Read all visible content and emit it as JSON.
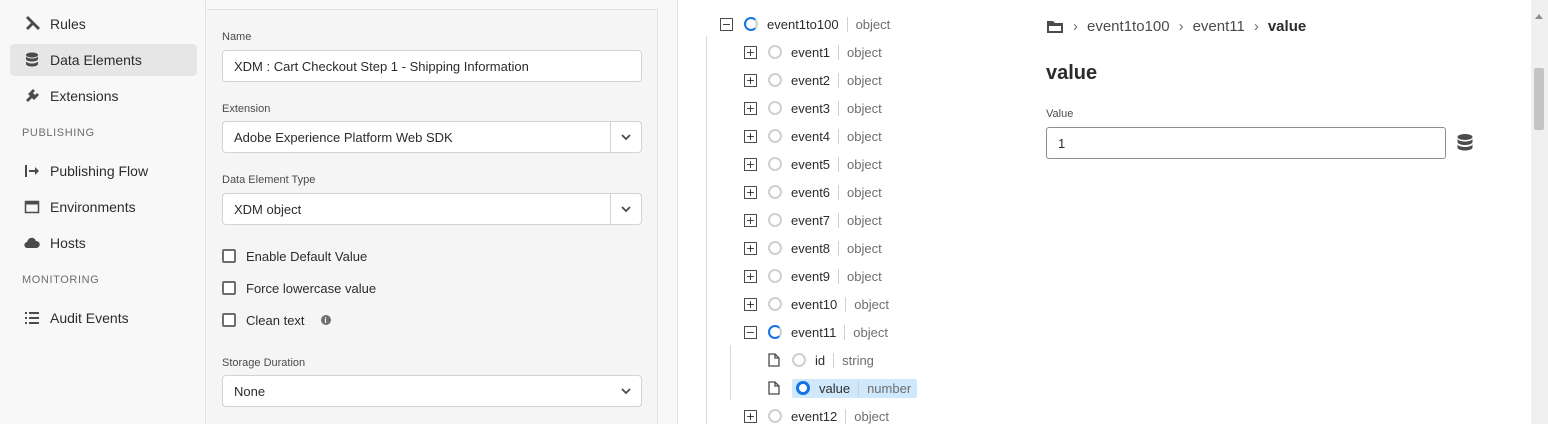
{
  "sidebar": {
    "items": [
      {
        "label": "Rules",
        "icon": "hammer-icon"
      },
      {
        "label": "Data Elements",
        "icon": "database-icon"
      },
      {
        "label": "Extensions",
        "icon": "plug-icon"
      },
      {
        "label": "Publishing Flow",
        "icon": "publish-flow-icon"
      },
      {
        "label": "Environments",
        "icon": "window-icon"
      },
      {
        "label": "Hosts",
        "icon": "cloud-icon"
      },
      {
        "label": "Audit Events",
        "icon": "list-icon"
      }
    ],
    "sections": {
      "publishing": "PUBLISHING",
      "monitoring": "MONITORING"
    }
  },
  "form": {
    "name_label": "Name",
    "name_value": "XDM : Cart Checkout Step 1 - Shipping Information",
    "extension_label": "Extension",
    "extension_value": "Adobe Experience Platform Web SDK",
    "type_label": "Data Element Type",
    "type_value": "XDM object",
    "checkboxes": [
      {
        "label": "Enable Default Value"
      },
      {
        "label": "Force lowercase value"
      },
      {
        "label": "Clean text"
      }
    ],
    "storage_label": "Storage Duration",
    "storage_value": "None"
  },
  "tree": {
    "root": {
      "name": "event1to100",
      "type": "object"
    },
    "events": [
      {
        "name": "event1",
        "type": "object"
      },
      {
        "name": "event2",
        "type": "object"
      },
      {
        "name": "event3",
        "type": "object"
      },
      {
        "name": "event4",
        "type": "object"
      },
      {
        "name": "event5",
        "type": "object"
      },
      {
        "name": "event6",
        "type": "object"
      },
      {
        "name": "event7",
        "type": "object"
      },
      {
        "name": "event8",
        "type": "object"
      },
      {
        "name": "event9",
        "type": "object"
      },
      {
        "name": "event10",
        "type": "object"
      },
      {
        "name": "event11",
        "type": "object"
      },
      {
        "name": "event12",
        "type": "object"
      }
    ],
    "children": [
      {
        "name": "id",
        "type": "string"
      },
      {
        "name": "value",
        "type": "number"
      }
    ]
  },
  "detail": {
    "breadcrumb": [
      "event1to100",
      "event11",
      "value"
    ],
    "breadcrumb_sep": "›",
    "title": "value",
    "value_label": "Value",
    "value": "1"
  },
  "colors": {
    "accent": "#1473e6",
    "selection": "#cfe8fc"
  }
}
